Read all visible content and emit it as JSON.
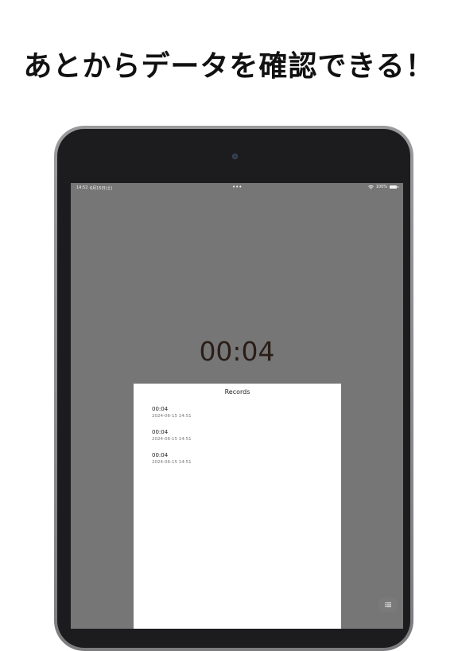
{
  "headline": "あとからデータを確認できる！",
  "status_bar": {
    "time": "14:52",
    "date": "6月15日(土)",
    "dots": "•••",
    "battery": "100%"
  },
  "timer": {
    "display": "00:04"
  },
  "records_sheet": {
    "title": "Records",
    "items": [
      {
        "duration": "00:04",
        "timestamp": "2024-06-15 14:51"
      },
      {
        "duration": "00:04",
        "timestamp": "2024-06-15 14:51"
      },
      {
        "duration": "00:04",
        "timestamp": "2024-06-15 14:51"
      }
    ]
  },
  "icons": {
    "wifi": "wifi-icon",
    "battery": "battery-icon",
    "list": "list-icon"
  },
  "colors": {
    "screen_background": "#767676",
    "timer_text": "#2a1d18",
    "sheet_background": "#ffffff"
  }
}
